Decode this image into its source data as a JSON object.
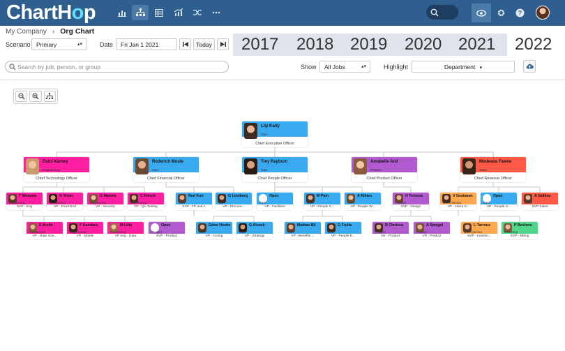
{
  "brand": {
    "logo_main": "ChartH",
    "logo_accent": "o",
    "logo_end": "p"
  },
  "header": {
    "nav_icons": [
      "bar-chart-icon",
      "org-chart-icon",
      "table-icon",
      "trend-chart-icon",
      "shuffle-icon",
      "more-icon"
    ],
    "right_icons": [
      "search-icon",
      "eye-icon",
      "gear-icon",
      "help-icon",
      "user-avatar"
    ]
  },
  "breadcrumb": {
    "parent": "My Company",
    "separator": "›",
    "current": "Org Chart"
  },
  "controls": {
    "scenario_label": "Scenario",
    "scenario_value": "Primary",
    "date_label": "Date",
    "date_value": "Fri Jan 1 2021",
    "today_label": "Today",
    "show_label": "Show",
    "show_value": "All Jobs",
    "highlight_label": "Highlight",
    "highlight_value": "Department"
  },
  "years": [
    "2017",
    "2018",
    "2019",
    "2020",
    "2021",
    "2022"
  ],
  "active_year": "2022",
  "search": {
    "placeholder": "Search by job, person, or group"
  },
  "colors": {
    "topbar": "#2f5f8e",
    "executive": "#3aaaf0",
    "engineering": "#ff1fa0",
    "product": "#b25ad0",
    "sales": "#ff5a48",
    "client_service": "#ffa850",
    "marketing": "#4fd68c"
  },
  "org": {
    "ceo": {
      "name": "Lily Karly",
      "dept": "G&A",
      "title": "Chief Executive Officer"
    },
    "execs": [
      {
        "name": "Dulci Karney",
        "dept": "Engineering",
        "title": "Chief Technology Officer"
      },
      {
        "name": "Roderich Moule",
        "dept": "G&A",
        "title": "Chief Financial Officer"
      },
      {
        "name": "Trey Rayburn",
        "dept": "G&A",
        "title": "Chief People Officer"
      },
      {
        "name": "Amabelle Anil",
        "dept": "Product",
        "title": "Chief Product Officer"
      },
      {
        "name": "Modestia Fawne",
        "dept": "Sales",
        "title": "Chief Revenue Officer"
      }
    ],
    "row1": [
      {
        "name": "T Wenona",
        "dept": "Engineering",
        "title": "SVP - Eng"
      },
      {
        "name": "G Virtac",
        "dept": "Engineering",
        "title": "VP - Front End"
      },
      {
        "name": "G Mariele",
        "dept": "Engineering",
        "title": "VP - Security"
      },
      {
        "name": "C Paisch",
        "dept": "Engineering",
        "title": "VP - QA Testing"
      },
      {
        "name": "Red Koo",
        "dept": "G&A",
        "title": "SVP - FP and A"
      },
      {
        "name": "G Lindberg",
        "dept": "G&A",
        "title": "VP - Procure..."
      },
      {
        "name": "Open",
        "dept": "G&A",
        "title": "VP - Facilities"
      },
      {
        "name": "M Pain",
        "dept": "G&A",
        "title": "VP - People C..."
      },
      {
        "name": "A Killam",
        "dept": "G&A",
        "title": "VP - People W..."
      },
      {
        "name": "H Teressa",
        "dept": "Product",
        "title": "SVP - Design"
      },
      {
        "name": "V Grubman",
        "dept": "Client Service",
        "title": "VP - Client S..."
      },
      {
        "name": "Open",
        "dept": "G&A",
        "title": "VP - People S..."
      },
      {
        "name": "A Saillieu",
        "dept": "Sales",
        "title": "SVP Sales"
      }
    ],
    "row2": [
      {
        "name": "E Arelle",
        "dept": "Engineering",
        "title": "VP - Data Scie..."
      },
      {
        "name": "F Kandace",
        "dept": "Engineering",
        "title": "VP - Mobile"
      },
      {
        "name": "M Litta",
        "dept": "Engineering",
        "title": "VP Eng - Data"
      },
      {
        "name": "Open",
        "dept": "Product",
        "title": "SVP - Product"
      },
      {
        "name": "Edwe Hestie",
        "dept": "G&A",
        "title": "VP - Acctng"
      },
      {
        "name": "G Alcock",
        "dept": "G&A",
        "title": "VP - Strategy"
      },
      {
        "name": "Mattias Bil",
        "dept": "G&A",
        "title": "VP - Benefits ..."
      },
      {
        "name": "G Frulla",
        "dept": "G&A",
        "title": "VP - People E..."
      },
      {
        "name": "R Clerissa",
        "dept": "Product",
        "title": "Dir - Product"
      },
      {
        "name": "A Spiegel",
        "dept": "Product",
        "title": "VP - Product"
      },
      {
        "name": "L Tarrous",
        "dept": "Client Service",
        "title": "SVP - Learnin..."
      },
      {
        "name": "P Beshere",
        "dept": "Marketing",
        "title": "SVP - Mktng"
      }
    ]
  }
}
